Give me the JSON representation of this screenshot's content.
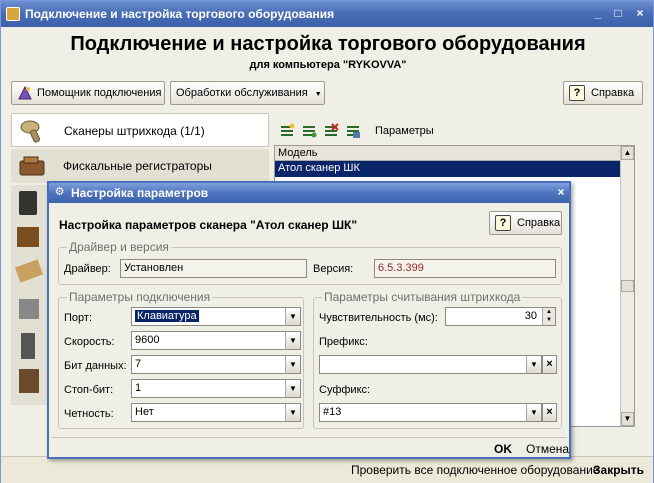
{
  "window": {
    "title": "Подключение и настройка торгового оборудования",
    "min_glyph": "_",
    "max_glyph": "□",
    "close_glyph": "×"
  },
  "header": {
    "title": "Подключение и настройка торгового оборудования",
    "subtitle": "для компьютера \"RYKOVVA\""
  },
  "toolbar": {
    "wizard_label": "Помощник подключения",
    "service_label": "Обработки обслуживания",
    "service_arrow": "▼",
    "help_label": "Справка",
    "help_glyph": "?"
  },
  "devices": [
    {
      "label": "Сканеры штрихкода (1/1)",
      "icon": "barcode-scanner-icon"
    },
    {
      "label": "Фискальные регистраторы",
      "icon": "fiscal-register-icon"
    }
  ],
  "right_panel": {
    "params_label": "Параметры",
    "column_model": "Модель",
    "selected_model": "Атол сканер ШК"
  },
  "bottom": {
    "check_all": "Проверить все подключенное оборудование",
    "close": "Закрыть"
  },
  "dialog": {
    "title": "Настройка параметров",
    "icon_glyph": "⚙",
    "close_glyph": "×",
    "heading": "Настройка параметров сканера \"Атол сканер ШК\"",
    "help_label": "Справка",
    "help_glyph": "?",
    "driver_group": "Драйвер и версия",
    "driver_label": "Драйвер:",
    "driver_value": "Установлен",
    "version_label": "Версия:",
    "version_value": "6.5.3.399",
    "conn_group": "Параметры подключения",
    "port_label": "Порт:",
    "port_value": "Клавиатура",
    "speed_label": "Скорость:",
    "speed_value": "9600",
    "databits_label": "Бит данных:",
    "databits_value": "7",
    "stopbit_label": "Стоп-бит:",
    "stopbit_value": "1",
    "parity_label": "Четность:",
    "parity_value": "Нет",
    "read_group": "Параметры считывания штрихкода",
    "sensitivity_label": "Чувствительность (мс):",
    "sensitivity_value": "30",
    "prefix_label": "Префикс:",
    "prefix_value": "",
    "suffix_label": "Суффикс:",
    "suffix_value": "#13",
    "dd_glyph": "▼",
    "clear_glyph": "×",
    "spin_up": "▲",
    "spin_down": "▼",
    "ok_label": "OK",
    "cancel_label": "Отмена"
  }
}
